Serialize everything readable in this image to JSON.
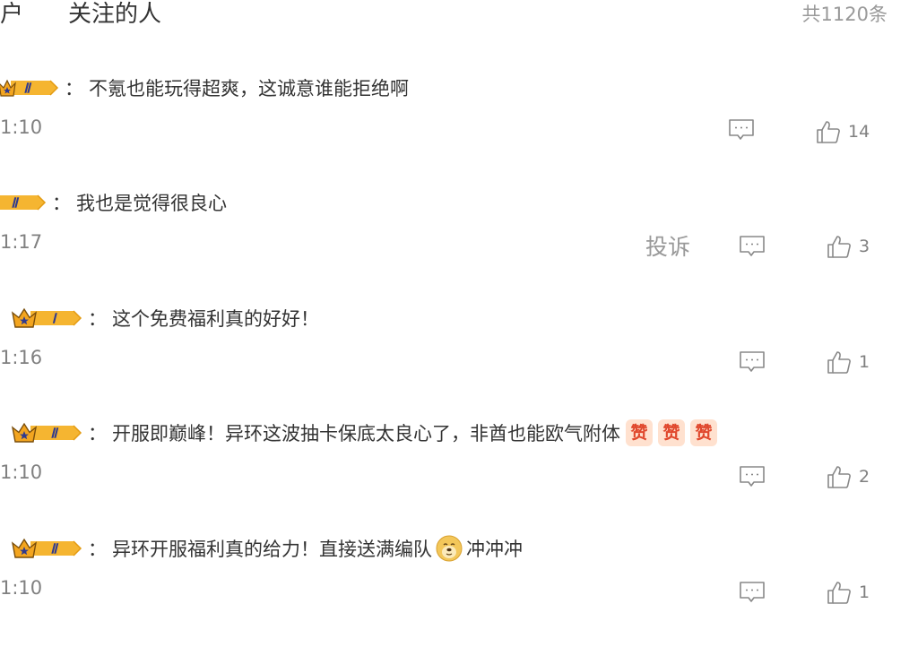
{
  "header": {
    "tab_cut_label": "户",
    "tab_follow_label": "关注的人",
    "total_label": "共1120条"
  },
  "comments": [
    {
      "badge_level": "II",
      "colon": "：",
      "text": "不氪也能玩得超爽，这诚意谁能拒绝啊",
      "time": "1:10",
      "likes": "14"
    },
    {
      "badge_level": "II",
      "colon": "：",
      "text": "我也是觉得很良心",
      "time": "1:17",
      "report_label": "投诉",
      "likes": "3"
    },
    {
      "badge_level": "I",
      "colon": "：",
      "text": "这个免费福利真的好好！",
      "time": "1:16",
      "likes": "1"
    },
    {
      "badge_level": "II",
      "colon": "：",
      "text": "开服即巅峰！异环这波抽卡保底太良心了，非酋也能欧气附体",
      "emoji": "赞",
      "time": "1:10",
      "likes": "2"
    },
    {
      "badge_level": "II",
      "colon": "：",
      "text_before": "异环开服福利真的给力！直接送满编队",
      "text_after": "冲冲冲",
      "time": "1:10",
      "likes": "1"
    }
  ],
  "colors": {
    "badge_gold": "#f5b531",
    "badge_blue": "#2f3a8f",
    "icon_gray": "#888888"
  },
  "icons": {
    "reply": "comment-icon",
    "like": "thumbs-up-icon",
    "badge": "crown-badge-icon"
  }
}
